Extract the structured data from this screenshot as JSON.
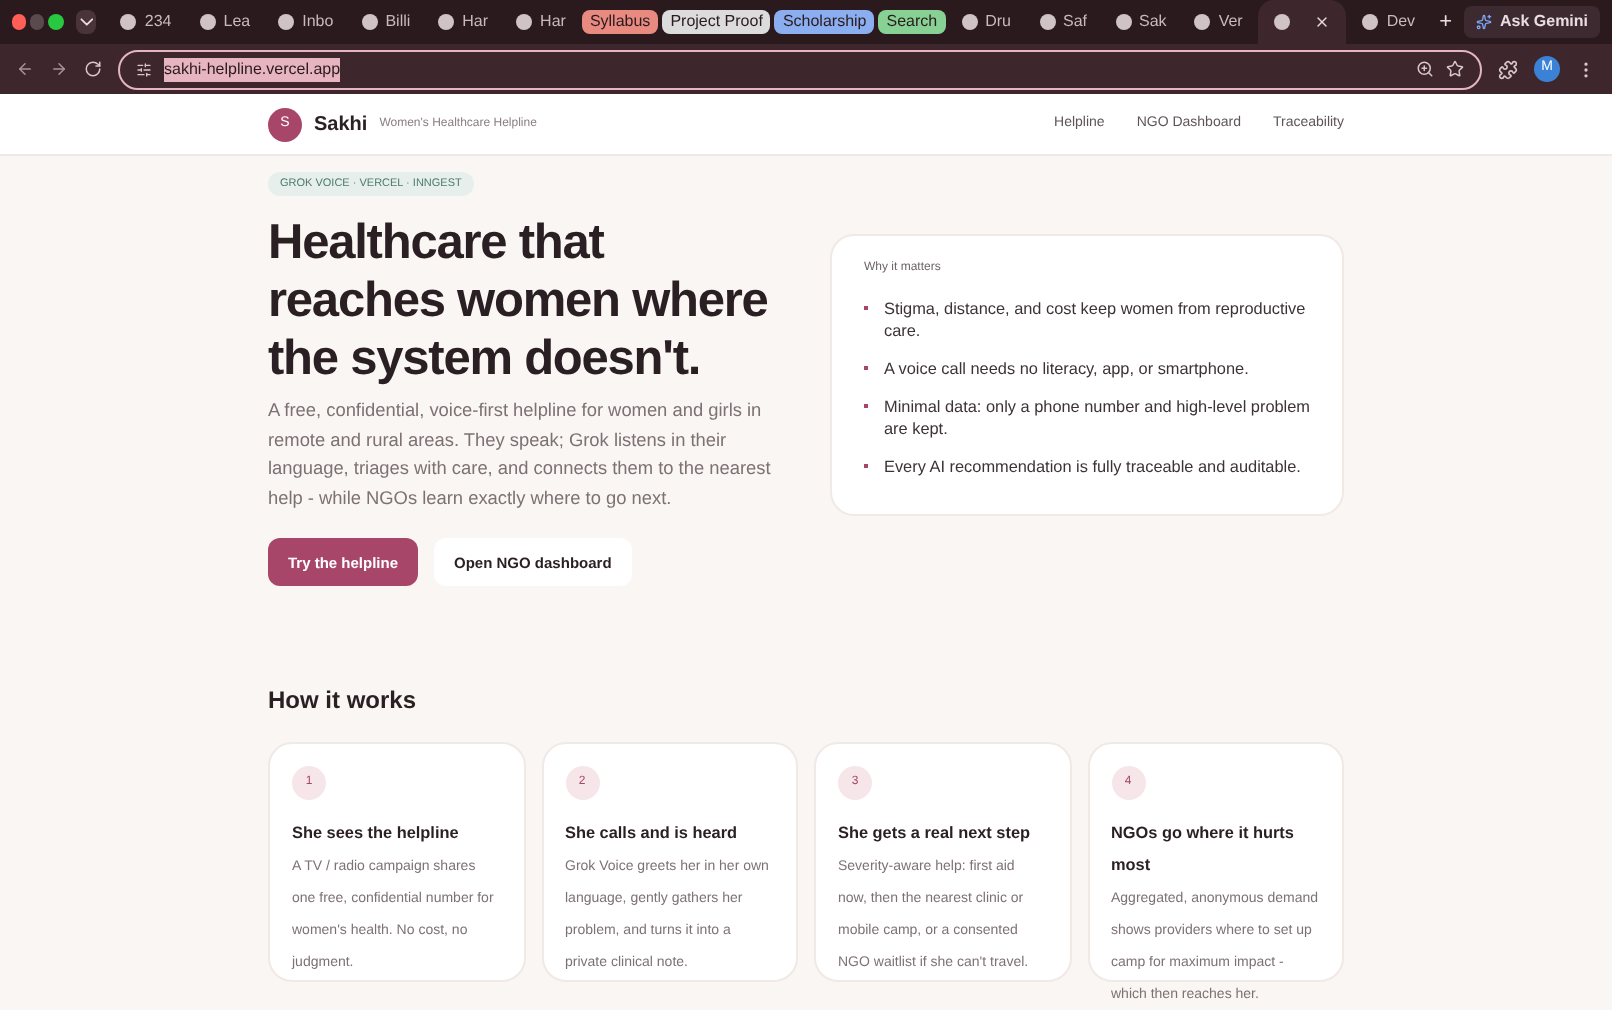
{
  "browser": {
    "tabs": [
      {
        "kind": "tab",
        "title": "234",
        "selected": false
      },
      {
        "kind": "tab",
        "title": "Lea",
        "selected": false
      },
      {
        "kind": "tab",
        "title": "Inbo",
        "selected": false
      },
      {
        "kind": "tab",
        "title": "Billi",
        "selected": false
      },
      {
        "kind": "tab",
        "title": "Har",
        "selected": false
      },
      {
        "kind": "tab",
        "title": "Har",
        "selected": false
      },
      {
        "kind": "group",
        "title": "Syllabus",
        "color": "#e88a80"
      },
      {
        "kind": "group",
        "title": "Project Proof",
        "color": "#dcdcdc"
      },
      {
        "kind": "group",
        "title": "Scholarship",
        "color": "#8aaef0"
      },
      {
        "kind": "group",
        "title": "Search",
        "color": "#86d193"
      },
      {
        "kind": "tab",
        "title": "Dru",
        "selected": false
      },
      {
        "kind": "tab",
        "title": "Saf",
        "selected": false
      },
      {
        "kind": "tab",
        "title": "Sak",
        "selected": false
      },
      {
        "kind": "tab",
        "title": "Ver",
        "selected": false
      },
      {
        "kind": "tab",
        "selected": true
      },
      {
        "kind": "tab",
        "title": "Dev",
        "selected": false
      }
    ],
    "new_tab": "+",
    "gemini": "Ask Gemini",
    "url": "sakhi-helpline.vercel.app",
    "avatar": "M"
  },
  "header": {
    "logo": "S",
    "brand": "Sakhi",
    "tagline": "Women's Healthcare Helpline",
    "nav": [
      "Helpline",
      "NGO Dashboard",
      "Traceability"
    ]
  },
  "hero": {
    "badge": "GROK VOICE · VERCEL · INNGEST",
    "title": "Healthcare that reaches women where the system doesn't.",
    "text": "A free, confidential, voice-first helpline for women and girls in remote and rural areas. They speak; Grok listens in their language, triages with care, and connects them to the nearest help - while NGOs learn exactly where to go next.",
    "primary_button": "Try the helpline",
    "secondary_button": "Open NGO dashboard"
  },
  "why": {
    "title": "Why it matters",
    "points": [
      "Stigma, distance, and cost keep women from reproductive care.",
      "A voice call needs no literacy, app, or smartphone.",
      "Minimal data: only a phone number and high-level problem are kept.",
      "Every AI recommendation is fully traceable and auditable."
    ]
  },
  "how": {
    "title": "How it works",
    "steps": [
      {
        "number": "1",
        "title": "She sees the helpline",
        "text": "A TV / radio campaign shares one free, confidential number for women's health. No cost, no judgment."
      },
      {
        "number": "2",
        "title": "She calls and is heard",
        "text": "Grok Voice greets her in her own language, gently gathers her problem, and turns it into a private clinical note."
      },
      {
        "number": "3",
        "title": "She gets a real next step",
        "text": "Severity-aware help: first aid now, then the nearest clinic or mobile camp, or a consented NGO waitlist if she can't travel."
      },
      {
        "number": "4",
        "title": "NGOs go where it hurts most",
        "text": "Aggregated, anonymous demand shows providers where to set up camp for maximum impact - which then reaches her."
      }
    ]
  }
}
